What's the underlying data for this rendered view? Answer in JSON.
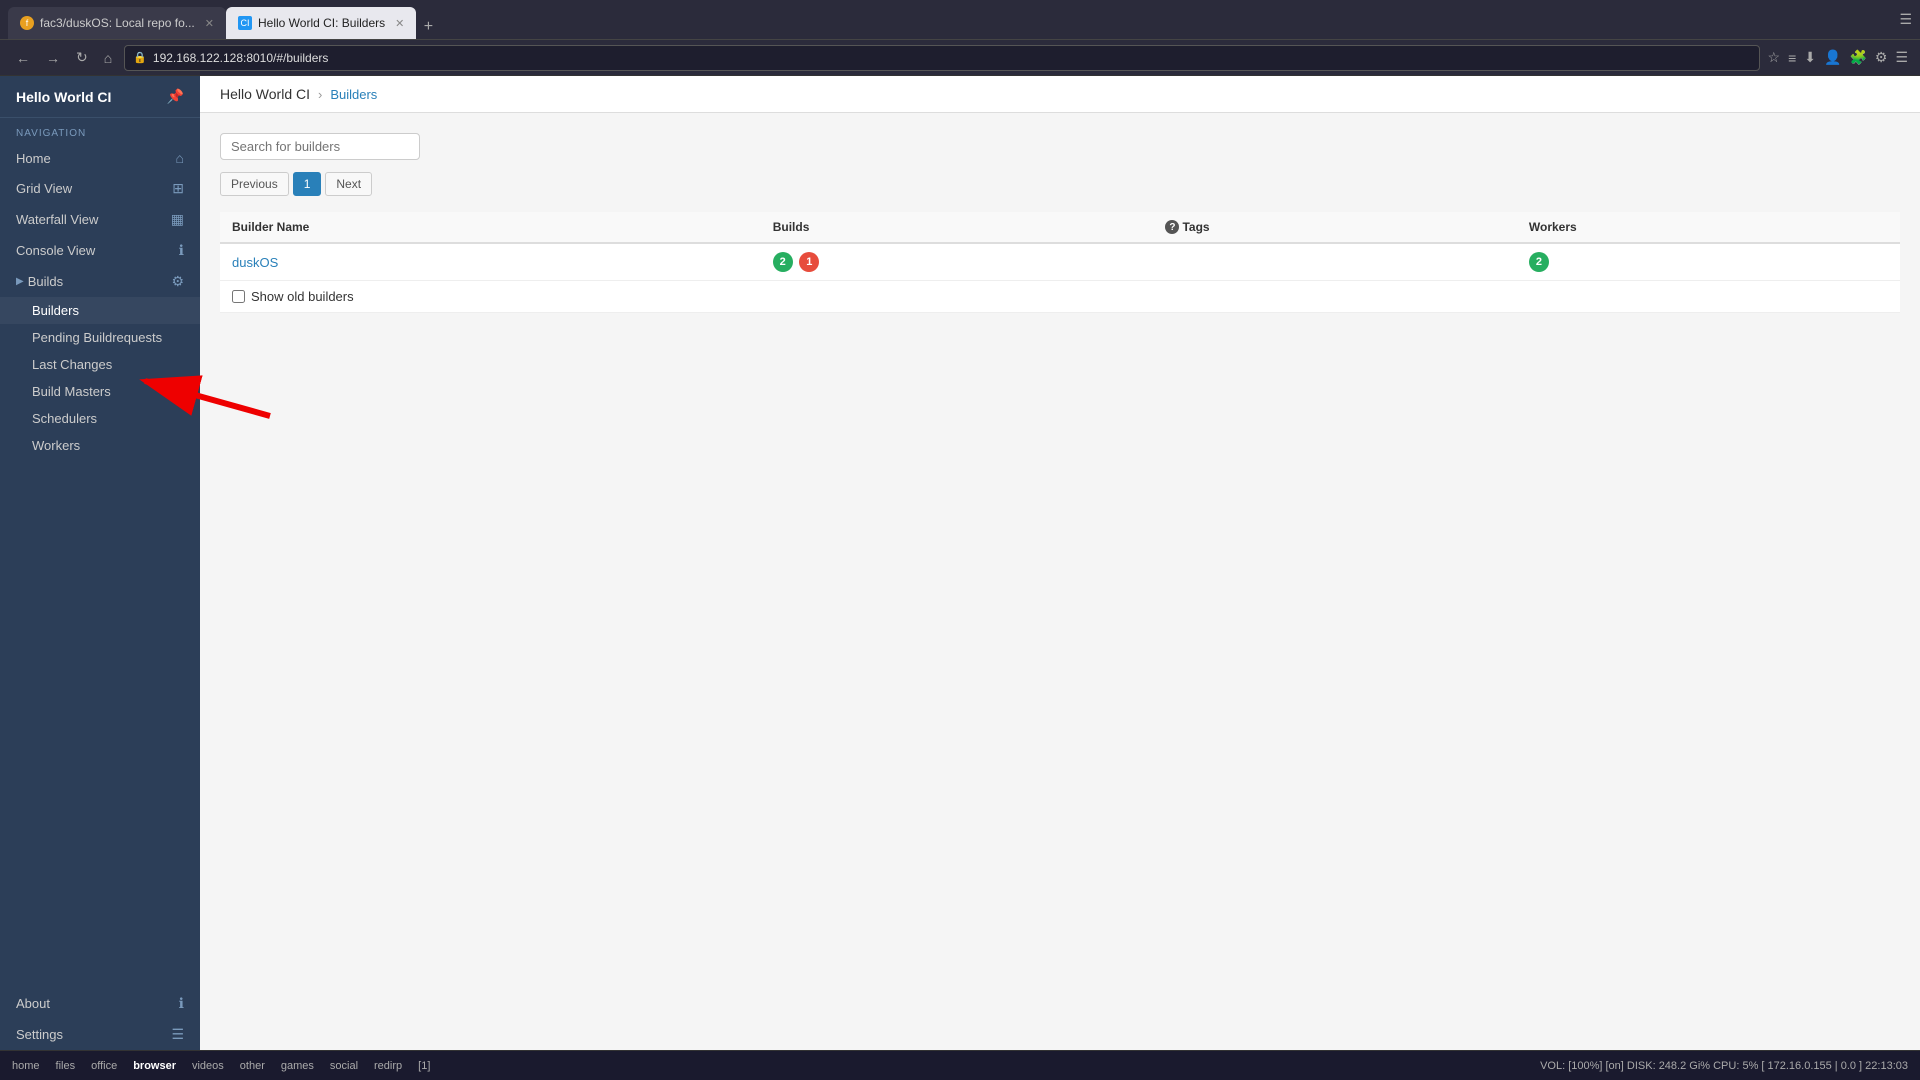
{
  "browser": {
    "tabs": [
      {
        "id": "tab1",
        "label": "fac3/duskOS: Local repo fo...",
        "active": false,
        "favicon_type": "repo"
      },
      {
        "id": "tab2",
        "label": "Hello World CI: Builders",
        "active": true,
        "favicon_type": "ci"
      }
    ],
    "url": "192.168.122.128:8010/#/builders",
    "new_tab_icon": "+"
  },
  "sidebar": {
    "title": "Hello World CI",
    "pin_icon": "📌",
    "nav_section_label": "NAVIGATION",
    "items": [
      {
        "id": "home",
        "label": "Home",
        "icon": "⌂",
        "has_sub": false
      },
      {
        "id": "grid-view",
        "label": "Grid View",
        "icon": "⊞",
        "has_sub": false
      },
      {
        "id": "waterfall-view",
        "label": "Waterfall View",
        "icon": "▦",
        "has_sub": false
      },
      {
        "id": "console-view",
        "label": "Console View",
        "icon": "ℹ",
        "has_sub": false
      },
      {
        "id": "builds",
        "label": "Builds",
        "icon": "⚙",
        "has_sub": true,
        "expanded": true
      }
    ],
    "sub_items": [
      {
        "id": "builders",
        "label": "Builders",
        "active": true
      },
      {
        "id": "pending-buildrequests",
        "label": "Pending Buildrequests",
        "active": false
      },
      {
        "id": "last-changes",
        "label": "Last Changes",
        "active": false
      },
      {
        "id": "build-masters",
        "label": "Build Masters",
        "active": false
      },
      {
        "id": "schedulers",
        "label": "Schedulers",
        "active": false
      },
      {
        "id": "workers",
        "label": "Workers",
        "active": false
      }
    ],
    "bottom_items": [
      {
        "id": "about",
        "label": "About",
        "icon": "ℹ"
      },
      {
        "id": "settings",
        "label": "Settings",
        "icon": "☰"
      }
    ]
  },
  "breadcrumb": {
    "root": "Hello World CI",
    "current": "Builders"
  },
  "search": {
    "placeholder": "Search for builders"
  },
  "pagination": {
    "previous_label": "Previous",
    "page_number": "1",
    "next_label": "Next"
  },
  "table": {
    "columns": [
      {
        "id": "builder-name",
        "label": "Builder Name"
      },
      {
        "id": "builds",
        "label": "Builds"
      },
      {
        "id": "tags",
        "label": "Tags",
        "has_info": true
      },
      {
        "id": "workers",
        "label": "Workers"
      }
    ],
    "rows": [
      {
        "name": "duskOS",
        "link": "#/builders/duskOS",
        "builds_green": "2",
        "builds_red": "1",
        "tags": "",
        "workers_green": "2"
      }
    ],
    "show_old_builders_label": "Show old builders"
  },
  "status_bar": {
    "left_items": [
      "home",
      "files",
      "office",
      "browser",
      "videos",
      "other",
      "games",
      "social",
      "redirp"
    ],
    "indicator": "[1]",
    "right": "VOL: [100%] [on] DISK: 248.2 Gi% CPU: 5%  [ 172.16.0.155 | 0.0 ]  22:13:03"
  }
}
